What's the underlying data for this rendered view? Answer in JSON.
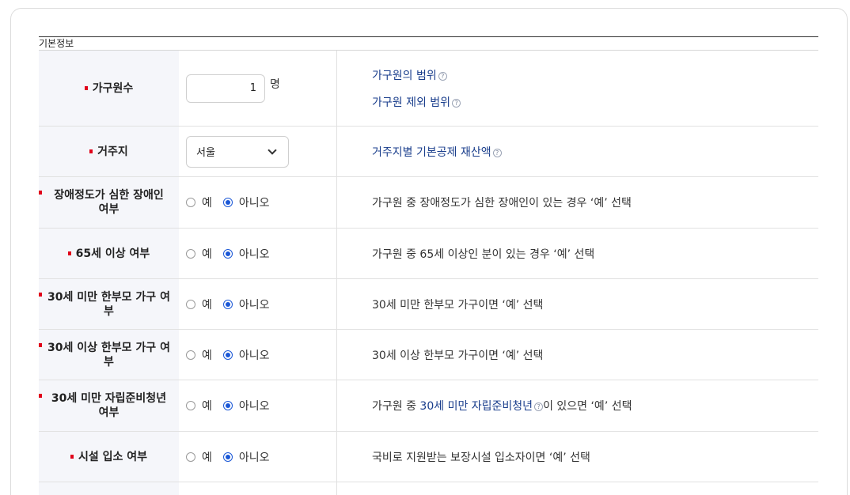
{
  "section": {
    "caption": "기본정보"
  },
  "rows": [
    {
      "label": "가구원수",
      "input_value": "1",
      "unit": "명",
      "links": [
        "가구원의 범위",
        "가구원 제외 범위"
      ]
    },
    {
      "label": "거주지",
      "select_value": "서울",
      "link": "거주지별 기본공제 재산액"
    },
    {
      "label_1": "장애정도가 심한 장애인",
      "label_2": "여부",
      "yes": "예",
      "no": "아니오",
      "selected": "no",
      "desc": "가구원 중 장애정도가 심한 장애인이 있는 경우 ‘예’ 선택"
    },
    {
      "label": "65세 이상 여부",
      "yes": "예",
      "no": "아니오",
      "selected": "no",
      "desc": "가구원 중 65세 이상인 분이 있는 경우 ‘예’ 선택"
    },
    {
      "label_1": "30세 미만 한부모 가구 여",
      "label_2": "부",
      "yes": "예",
      "no": "아니오",
      "selected": "no",
      "desc": "30세 미만 한부모 가구이면 ‘예’ 선택"
    },
    {
      "label_1": "30세 이상 한부모 가구 여",
      "label_2": "부",
      "yes": "예",
      "no": "아니오",
      "selected": "no",
      "desc": "30세 이상 한부모 가구이면 ‘예’ 선택"
    },
    {
      "label_1": "30세 미만 자립준비청년",
      "label_2": "여부",
      "yes": "예",
      "no": "아니오",
      "selected": "no",
      "desc_pre": "가구원 중 ",
      "desc_link": "30세 미만 자립준비청년",
      "desc_post": "이 있으면 ‘예’ 선택"
    },
    {
      "label": "시설 입소 여부",
      "yes": "예",
      "no": "아니오",
      "selected": "no",
      "desc": "국비로 지원받는 보장시설 입소자이면 ‘예’ 선택"
    }
  ],
  "icons": {
    "help": "help-question-icon",
    "select": "chevron-down-icon",
    "required": "required-marker-icon"
  },
  "colors": {
    "required": "#e0001a",
    "link": "#1a3e8c",
    "radio_on": "#1a57d6",
    "header_bg": "#f5f6fa"
  }
}
